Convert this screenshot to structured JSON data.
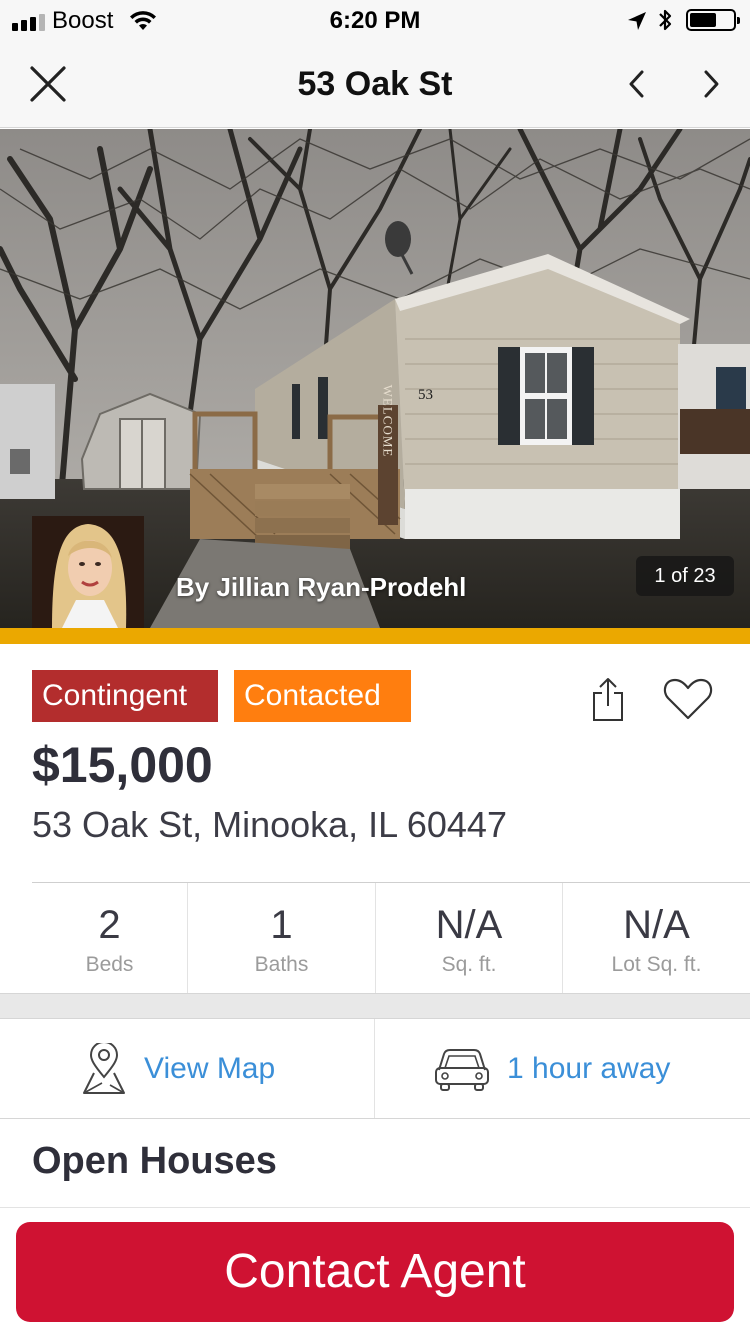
{
  "status_bar": {
    "carrier": "Boost",
    "time": "6:20 PM",
    "signal_bars": 3,
    "battery_level": 0.55
  },
  "nav": {
    "title": "53 Oak St",
    "close_icon": "close-icon",
    "prev_icon": "chevron-left-icon",
    "next_icon": "chevron-right-icon"
  },
  "hero": {
    "agent_name": "By Jillian Ryan-Prodehl",
    "photo_counter": "1 of 23",
    "house_number": "53",
    "welcome_sign": "WELCOME"
  },
  "listing": {
    "badges": [
      {
        "label": "Contingent",
        "color": "#b32d2d"
      },
      {
        "label": "Contacted",
        "color": "#ff7e0f"
      }
    ],
    "price": "$15,000",
    "address": "53 Oak St, Minooka, IL 60447"
  },
  "facts": [
    {
      "value": "2",
      "label": "Beds"
    },
    {
      "value": "1",
      "label": "Baths"
    },
    {
      "value": "N/A",
      "label": "Sq. ft."
    },
    {
      "value": "N/A",
      "label": "Lot Sq. ft."
    }
  ],
  "actions": {
    "map_label": "View Map",
    "map_icon": "map-pin-icon",
    "drive_label": "1 hour away",
    "drive_icon": "car-icon"
  },
  "sections": {
    "open_houses": "Open Houses"
  },
  "cta": {
    "label": "Contact Agent"
  },
  "colors": {
    "accent_bar": "#eba800",
    "link": "#3b8fd8",
    "cta": "#cf1232"
  }
}
